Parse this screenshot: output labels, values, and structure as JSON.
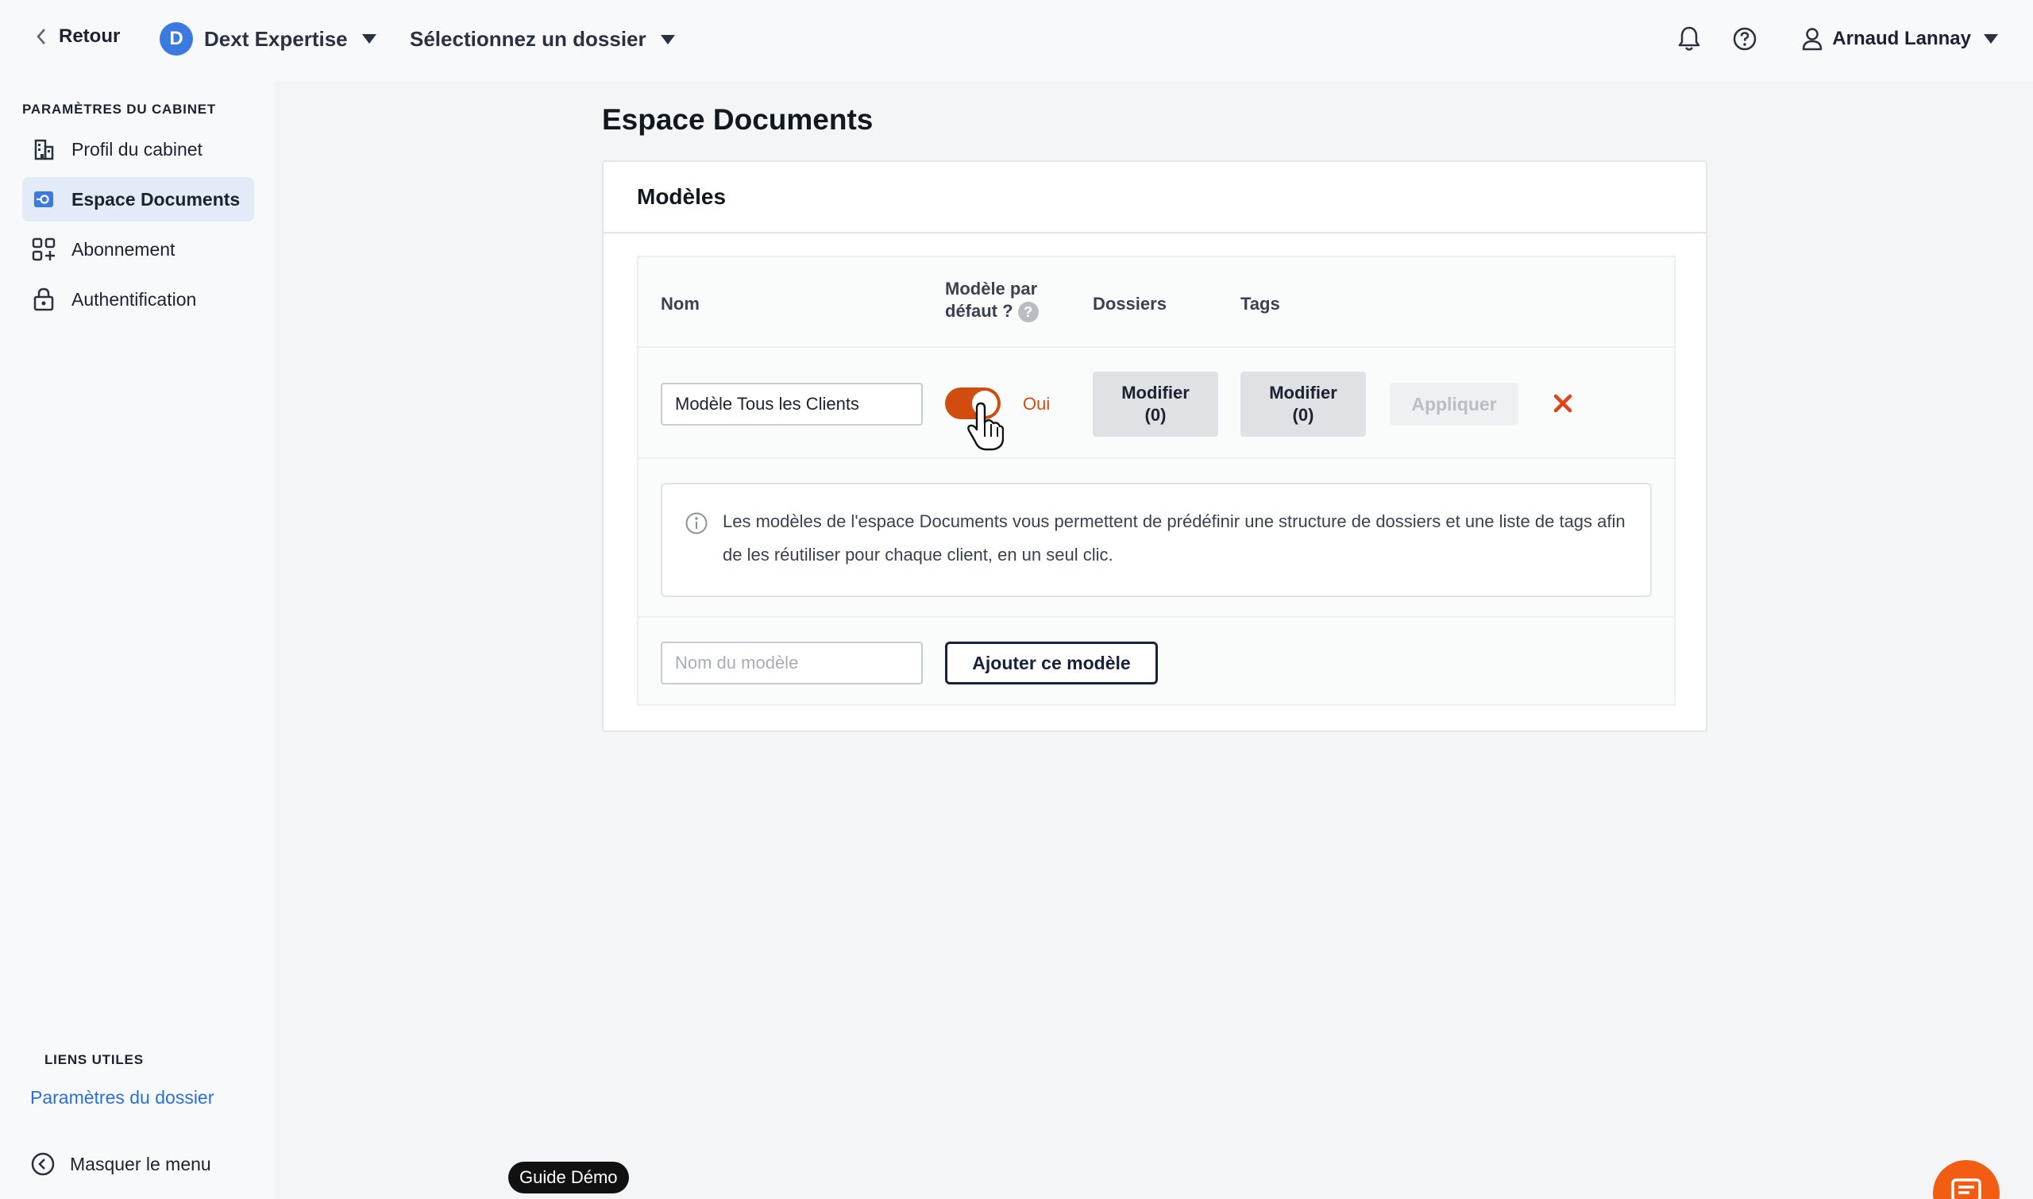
{
  "topbar": {
    "back_label": "Retour",
    "org_initial": "D",
    "org_name": "Dext Expertise",
    "folder_select": "Sélectionnez un dossier",
    "user_name": "Arnaud Lannay"
  },
  "sidebar": {
    "heading": "PARAMÈTRES DU CABINET",
    "items": [
      {
        "label": "Profil du cabinet",
        "icon": "building-icon"
      },
      {
        "label": "Espace Documents",
        "icon": "documents-space-icon",
        "active": true
      },
      {
        "label": "Abonnement",
        "icon": "apps-plus-icon"
      },
      {
        "label": "Authentification",
        "icon": "lock-icon"
      }
    ],
    "links_heading": "LIENS UTILES",
    "folder_settings_link": "Paramètres du dossier",
    "hide_menu": "Masquer le menu"
  },
  "main": {
    "page_title": "Espace Documents",
    "card_title": "Modèles",
    "columns": {
      "name": "Nom",
      "default_line1": "Modèle par",
      "default_line2": "défaut ?",
      "folders": "Dossiers",
      "tags": "Tags"
    },
    "row": {
      "name_value": "Modèle Tous les Clients",
      "default_on": true,
      "default_label": "Oui",
      "folders_btn_line1": "Modifier",
      "folders_btn_line2": "(0)",
      "tags_btn_line1": "Modifier",
      "tags_btn_line2": "(0)",
      "apply_label": "Appliquer"
    },
    "info_text": "Les modèles de l'espace Documents vous permettent de prédéfinir une structure de dossiers et une liste de tags afin de les réutiliser pour chaque client, en un seul clic.",
    "new_model_placeholder": "Nom du modèle",
    "add_button": "Ajouter ce modèle"
  },
  "footer": {
    "guide_label": "Guide Démo"
  },
  "colors": {
    "accent": "#d14d0f",
    "link": "#2a6fdb",
    "org_badge": "#3b7be0",
    "chat_fab": "#f25c13"
  }
}
